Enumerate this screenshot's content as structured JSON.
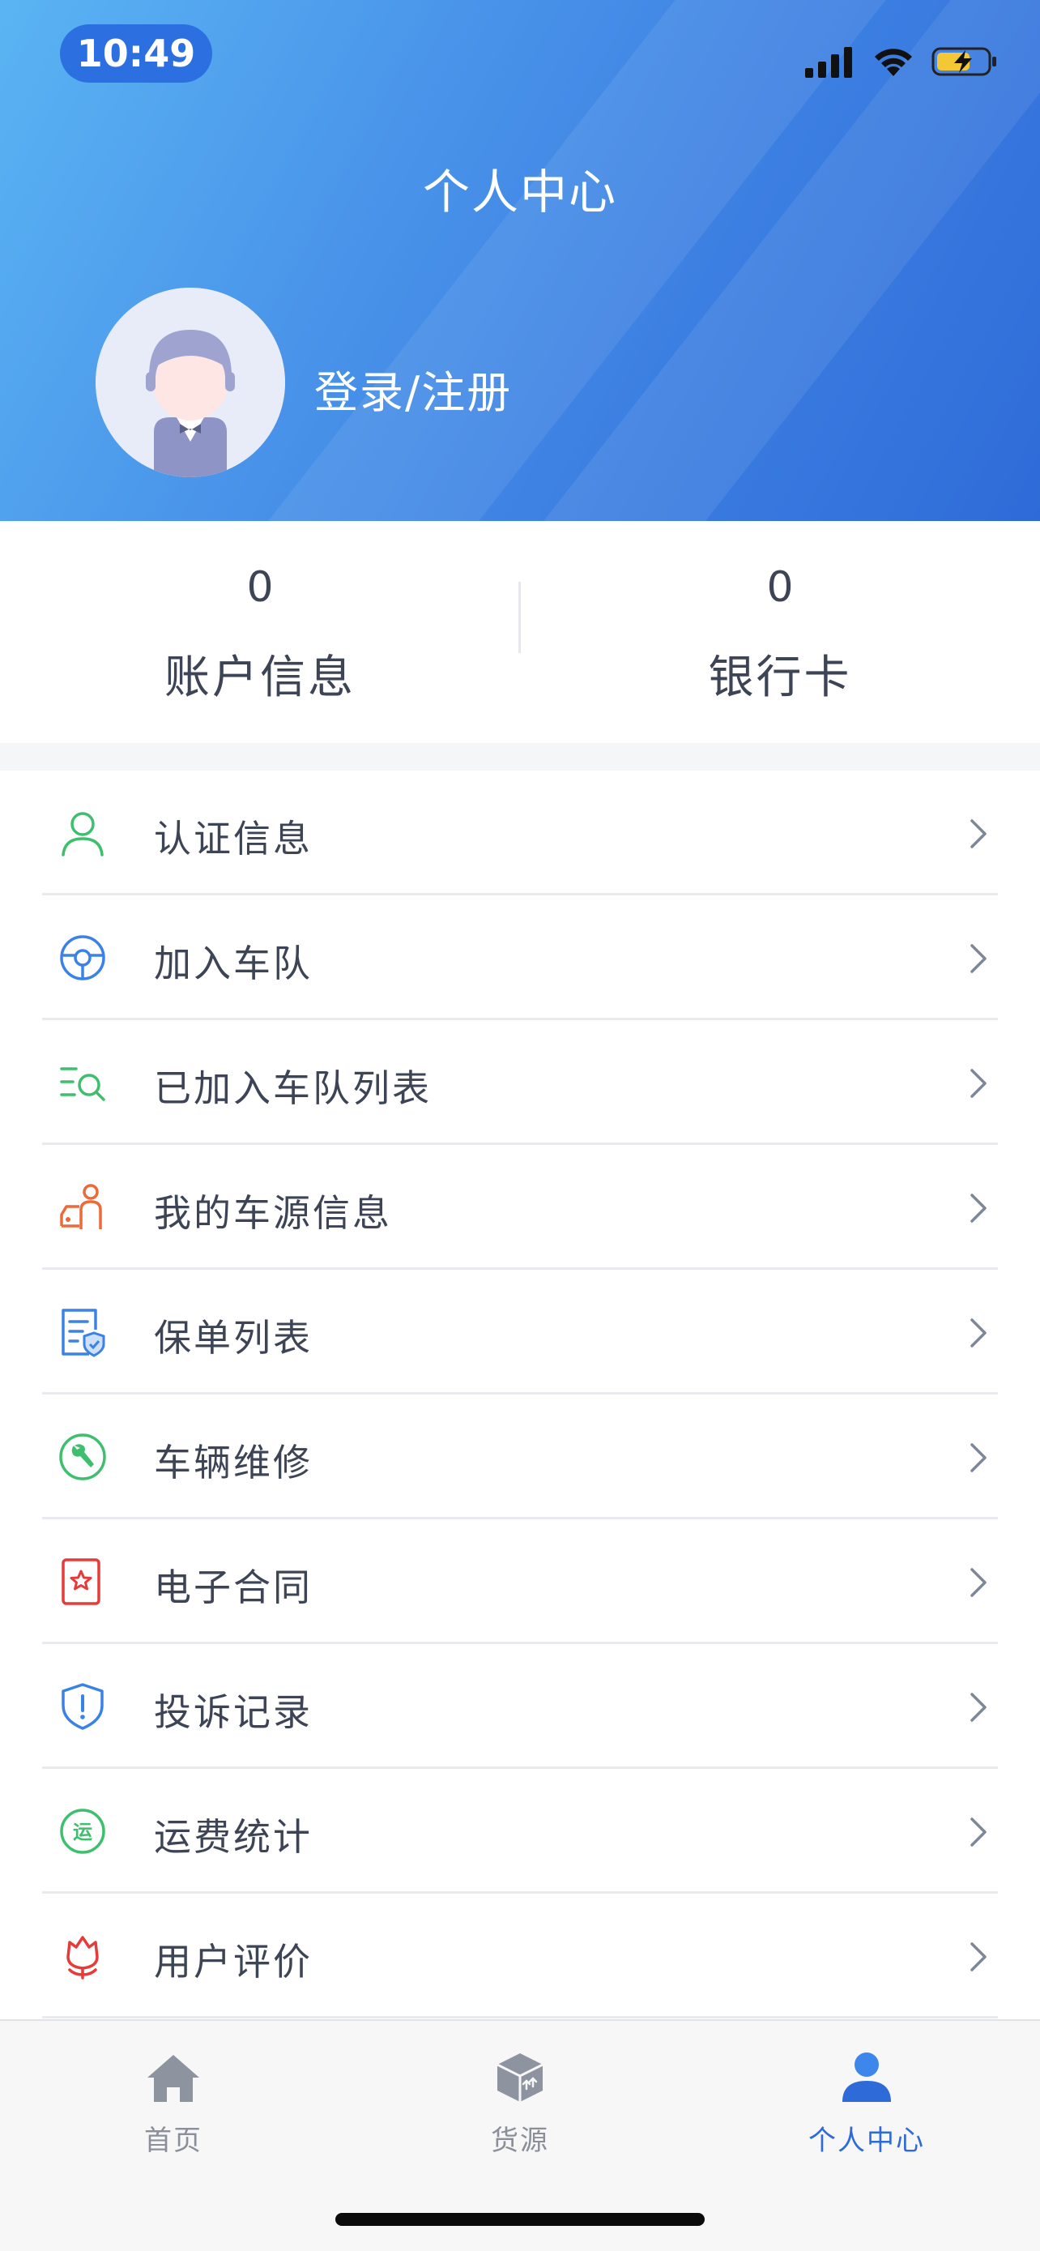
{
  "status_bar": {
    "time": "10:49",
    "icons": [
      "signal-icon",
      "wifi-icon",
      "battery-charging-icon"
    ]
  },
  "header": {
    "title": "个人中心",
    "login_text": "登录/注册",
    "avatar_icon": "default-avatar-icon"
  },
  "stats": [
    {
      "value": "0",
      "label": "账户信息"
    },
    {
      "value": "0",
      "label": "银行卡"
    }
  ],
  "menu": {
    "items": [
      {
        "label": "认证信息",
        "icon": "user-outline-icon",
        "color": "#3fbf6e"
      },
      {
        "label": "加入车队",
        "icon": "steering-wheel-icon",
        "color": "#3b82e6"
      },
      {
        "label": "已加入车队列表",
        "icon": "list-search-icon",
        "color": "#3fbf6e"
      },
      {
        "label": "我的车源信息",
        "icon": "driver-car-icon",
        "color": "#ea6a3a"
      },
      {
        "label": "保单列表",
        "icon": "policy-shield-icon",
        "color": "#3b82e6"
      },
      {
        "label": "车辆维修",
        "icon": "wrench-icon",
        "color": "#3fbf6e"
      },
      {
        "label": "电子合同",
        "icon": "contract-star-icon",
        "color": "#e63b3b"
      },
      {
        "label": "投诉记录",
        "icon": "shield-alert-icon",
        "color": "#3b82e6"
      },
      {
        "label": "运费统计",
        "icon": "freight-coin-icon",
        "color": "#3fbf6e",
        "icon_text": "运"
      },
      {
        "label": "用户评价",
        "icon": "flower-rating-icon",
        "color": "#e63b3b"
      }
    ],
    "chevron_icon": "chevron-right-icon"
  },
  "tabbar": {
    "tabs": [
      {
        "label": "首页",
        "icon": "home-icon",
        "active": false
      },
      {
        "label": "货源",
        "icon": "cargo-box-icon",
        "active": false
      },
      {
        "label": "个人中心",
        "icon": "person-icon",
        "active": true
      }
    ],
    "active_color": "#2f6bd8",
    "inactive_color": "#8a8f99"
  }
}
